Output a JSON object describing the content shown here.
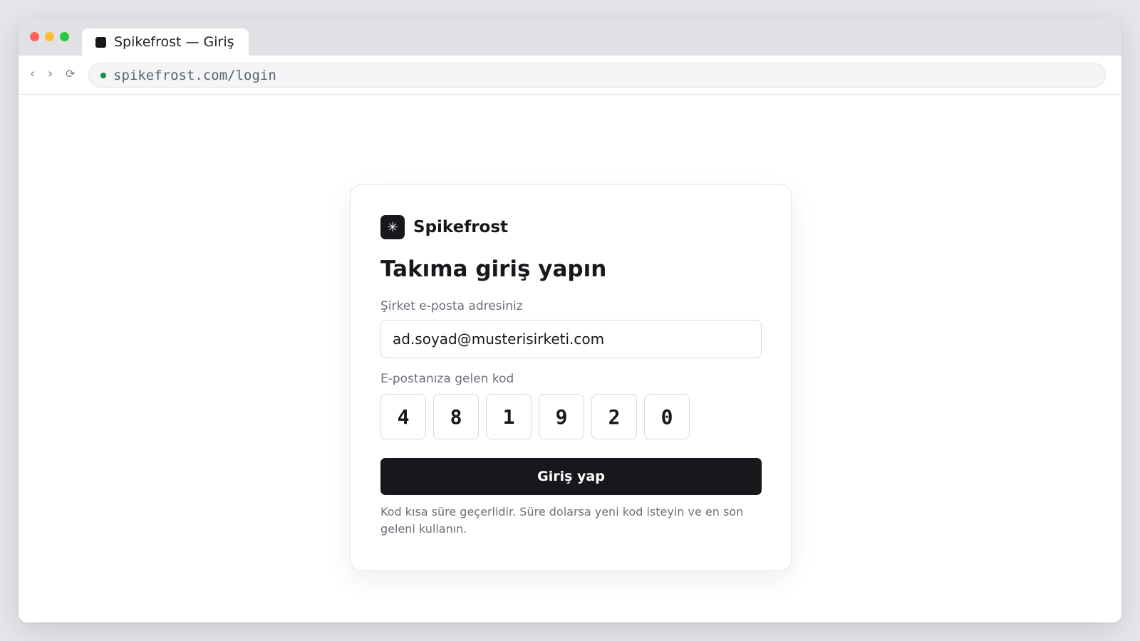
{
  "browser": {
    "tab_title": "Spikefrost — Giriş",
    "url": "spikefrost.com/login",
    "nav": {
      "back": "‹",
      "forward": "›",
      "reload": "⟳"
    }
  },
  "login": {
    "brand_mark": "✳",
    "brand_name": "Spikefrost",
    "heading": "Takıma giriş yapın",
    "email_label": "Şirket e-posta adresiniz",
    "email_value": "ad.soyad@musterisirketi.com",
    "code_label": "E-postanıza gelen kod",
    "code_digits": [
      "4",
      "8",
      "1",
      "9",
      "2",
      "0"
    ],
    "submit_label": "Giriş yap",
    "hint": "Kod kısa süre geçerlidir. Süre dolarsa yeni kod isteyin ve en son geleni kullanın."
  },
  "colors": {
    "primary": "#17181c",
    "secure_indicator": "#1f8a3a",
    "traffic_red": "#fe5f57",
    "traffic_yellow": "#febc2e",
    "traffic_green": "#28c840"
  }
}
